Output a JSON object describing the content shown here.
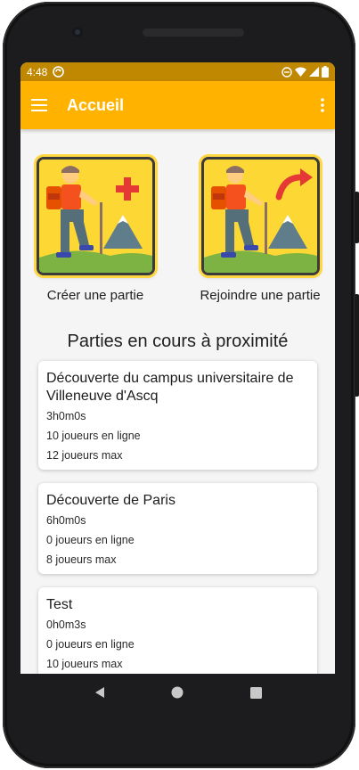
{
  "status_bar": {
    "time": "4:48",
    "icons": [
      "sync-icon",
      "do-not-disturb-icon",
      "wifi-icon",
      "cell-signal-icon",
      "battery-icon"
    ]
  },
  "app_bar": {
    "title": "Accueil",
    "menu_icon": "menu-icon",
    "more_icon": "more-vert-icon",
    "color": "#ffb300",
    "status_color": "#c08700"
  },
  "actions": [
    {
      "label": "Créer une partie",
      "badge_icon": "plus-icon"
    },
    {
      "label": "Rejoindre une partie",
      "badge_icon": "curved-arrow-icon"
    }
  ],
  "section_title": "Parties en cours à proximité",
  "games": [
    {
      "name": "Découverte du campus universitaire de Villeneuve d'Ascq",
      "duration": "3h0m0s",
      "online": "10 joueurs en ligne",
      "max": "12 joueurs max"
    },
    {
      "name": "Découverte de Paris",
      "duration": "6h0m0s",
      "online": "0 joueurs en ligne",
      "max": "8 joueurs max"
    },
    {
      "name": "Test",
      "duration": "0h0m3s",
      "online": "0 joueurs en ligne",
      "max": "10 joueurs max"
    }
  ],
  "nav_bar": {
    "icons": [
      "back-icon",
      "home-icon",
      "recents-icon"
    ]
  }
}
